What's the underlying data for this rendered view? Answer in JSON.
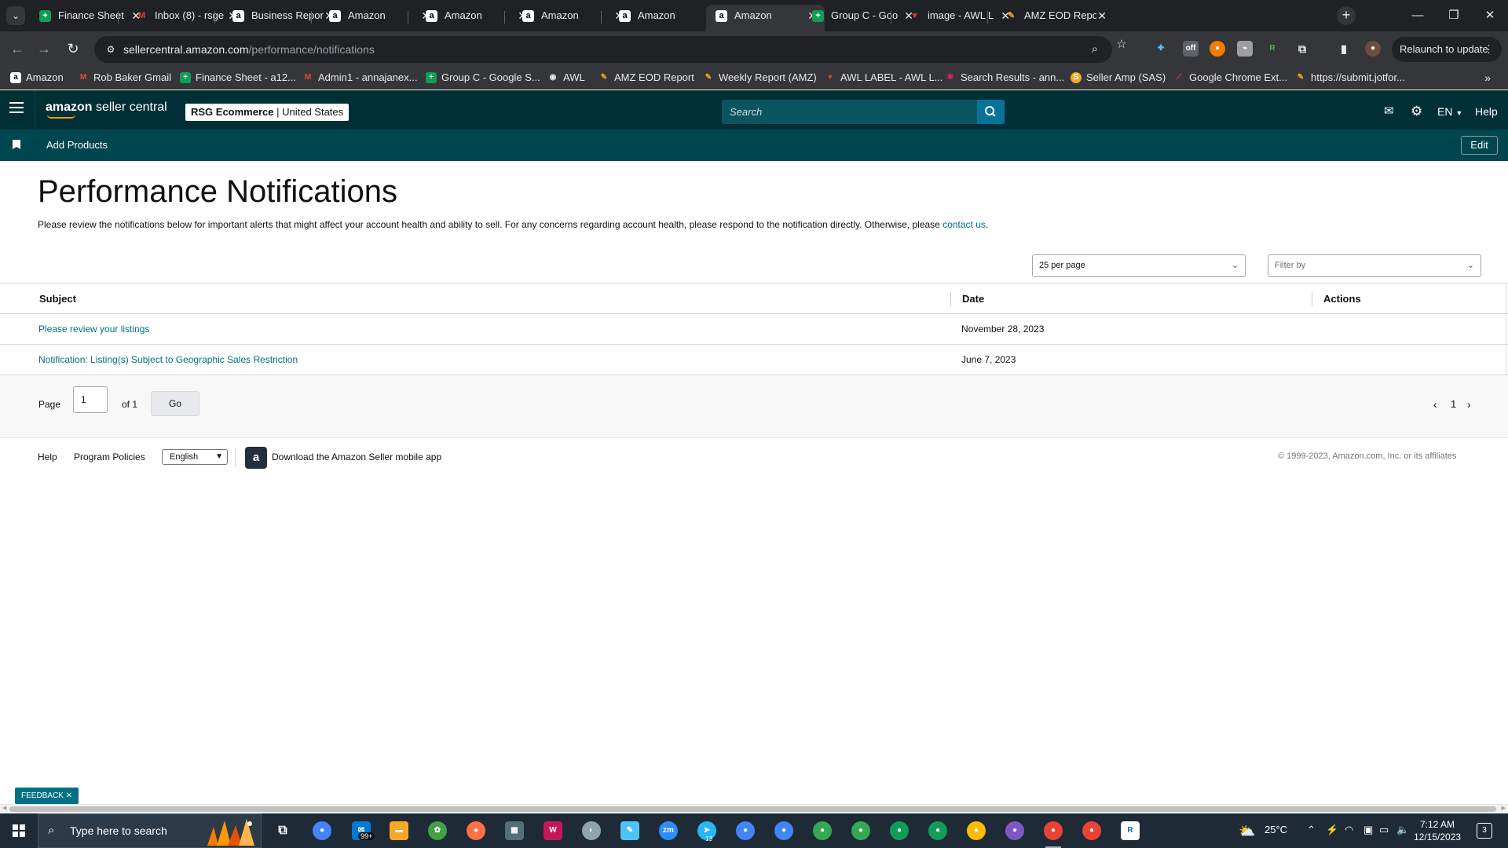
{
  "browser": {
    "tabs": [
      {
        "title": "Finance Sheet",
        "icon": "sheets-icon",
        "color": "#0f9d58"
      },
      {
        "title": "Inbox (8) - rsge",
        "icon": "gmail-icon",
        "color": "#ea4335"
      },
      {
        "title": "Business Repor",
        "icon": "amazon-icon",
        "color": "#ffffff"
      },
      {
        "title": "Amazon",
        "icon": "amazon-icon",
        "color": "#ffffff"
      },
      {
        "title": "Amazon",
        "icon": "amazon-icon",
        "color": "#ffffff"
      },
      {
        "title": "Amazon",
        "icon": "amazon-icon",
        "color": "#ffffff"
      },
      {
        "title": "Amazon",
        "icon": "amazon-icon",
        "color": "#ffffff"
      },
      {
        "title": "Amazon",
        "icon": "amazon-icon",
        "color": "#ffffff",
        "active": true
      },
      {
        "title": "Group C - Goo",
        "icon": "sheets-icon",
        "color": "#0f9d58"
      },
      {
        "title": "image - AWL L",
        "icon": "awl-icon",
        "color": "#e53935"
      },
      {
        "title": "AMZ EOD Repo",
        "icon": "awl-icon",
        "color": "#f9a825"
      }
    ],
    "url_host": "sellercentral.amazon.com",
    "url_path": "/performance/notifications",
    "relaunch_label": "Relaunch to update",
    "bookmarks": [
      {
        "label": "Amazon",
        "icon": "amazon-icon"
      },
      {
        "label": "Rob Baker Gmail",
        "icon": "gmail-icon"
      },
      {
        "label": "Finance Sheet - a12...",
        "icon": "sheets-icon"
      },
      {
        "label": "Admin1 - annajanex...",
        "icon": "gmail-icon"
      },
      {
        "label": "Group C - Google S...",
        "icon": "sheets-icon"
      },
      {
        "label": "AWL",
        "icon": "globe-icon"
      },
      {
        "label": "AMZ EOD Report",
        "icon": "awl-icon"
      },
      {
        "label": "Weekly Report (AMZ)",
        "icon": "awl-icon"
      },
      {
        "label": "AWL LABEL - AWL L...",
        "icon": "awl-icon"
      },
      {
        "label": "Search Results - ann...",
        "icon": "slack-icon"
      },
      {
        "label": "Seller Amp (SAS)",
        "icon": "selleramp-icon"
      },
      {
        "label": "Google Chrome Ext...",
        "icon": "chrome-ext-icon"
      },
      {
        "label": "https://submit.jotfor...",
        "icon": "jotform-icon"
      }
    ]
  },
  "header": {
    "brand_bold": "amazon",
    "brand_rest": " seller central",
    "account_name": "RSG Ecommerce",
    "marketplace": "United States",
    "search_placeholder": "Search",
    "language": "EN",
    "help_label": "Help"
  },
  "subnav": {
    "add_products_label": "Add Products",
    "edit_label": "Edit"
  },
  "page": {
    "title": "Performance Notifications",
    "intro_text": "Please review the notifications below for important alerts that might affect your account health and ability to sell. For any concerns regarding account health, please respond to the notification directly. Otherwise, please ",
    "intro_link": "contact us",
    "intro_end": ".",
    "per_page_value": "25 per page",
    "filter_placeholder": "Filter by"
  },
  "table": {
    "columns": [
      "Subject",
      "Date",
      "Actions"
    ],
    "rows": [
      {
        "subject": "Please review your listings",
        "date": "November 28, 2023"
      },
      {
        "subject": "Notification: Listing(s) Subject to Geographic Sales Restriction",
        "date": "June 7, 2023"
      }
    ]
  },
  "pagination": {
    "page_label": "Page",
    "page_value": "1",
    "of_label": "of 1",
    "go_label": "Go",
    "current_page": "1"
  },
  "footer": {
    "help_label": "Help",
    "policies_label": "Program Policies",
    "language_value": "English",
    "app_label": "Download the Amazon Seller mobile app",
    "copyright": "© 1999-2023, Amazon.com, Inc. or its affiliates"
  },
  "feedback_label": "FEEDBACK",
  "taskbar": {
    "search_placeholder": "Type here to search",
    "temperature": "25°C",
    "time": "7:12 AM",
    "date": "12/15/2023",
    "mail_badge": "99+",
    "telegram_badge": "13",
    "notification_count": "3"
  },
  "colors": {
    "header_bg": "#002f36",
    "subnav_bg": "#00464f",
    "link": "#007185",
    "accent": "#ff9900"
  }
}
